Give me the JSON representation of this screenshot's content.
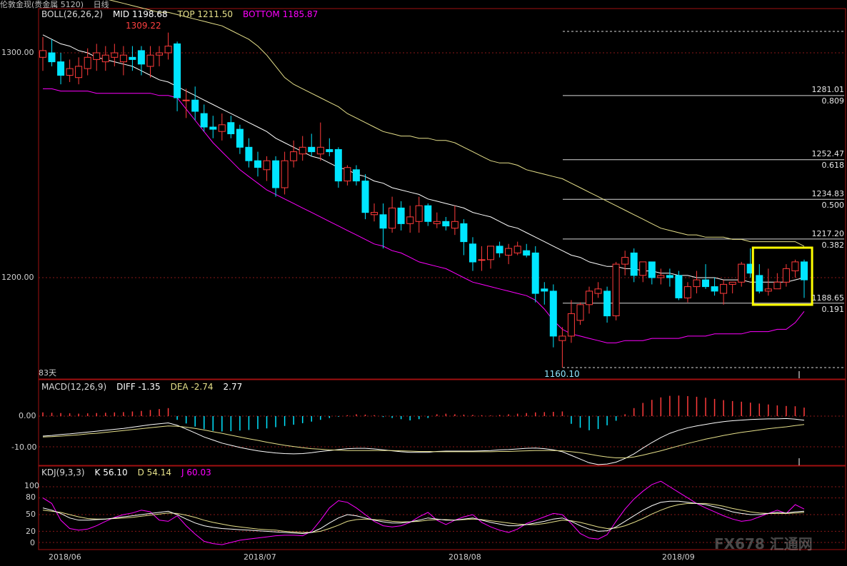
{
  "window": {
    "title": "伦敦金现(贵金属 5120)",
    "period": "日线"
  },
  "panels": {
    "main": {
      "indicator": "BOLL(26,26,2)",
      "mid": "MID 1198.68",
      "top": "TOP 1211.50",
      "bottom": "BOTTOM 1185.87",
      "high_label": "1309.22",
      "low_label": "1160.10",
      "days_label": "83天",
      "y_ticks": [
        "1300.00",
        "1200.00"
      ]
    },
    "macd": {
      "indicator": "MACD(12,26,9)",
      "diff": "DIFF -1.35",
      "dea": "DEA -2.74",
      "macd_val": "2.77",
      "y_ticks": [
        "0.00",
        "-10.00"
      ]
    },
    "kdj": {
      "indicator": "KDJ(9,3,3)",
      "k": "K 56.10",
      "d": "D 54.14",
      "j": "J 60.03",
      "y_ticks": [
        "100",
        "80",
        "50",
        "20",
        "0"
      ]
    }
  },
  "x_labels": [
    "2018/06",
    "2018/07",
    "2018/08",
    "2018/09"
  ],
  "fib_levels": [
    {
      "price": "1281.01",
      "ratio": "0.809"
    },
    {
      "price": "1252.47",
      "ratio": "0.618"
    },
    {
      "price": "1234.83",
      "ratio": "0.500"
    },
    {
      "price": "1217.20",
      "ratio": "0.382"
    },
    {
      "price": "1188.65",
      "ratio": "0.191"
    }
  ],
  "watermark": "FX678 汇通网",
  "colors": {
    "up": "#ff3b3b",
    "down": "#00e5ff",
    "mid": "#ffffff",
    "upper_band": "#e6e08a",
    "lower_band": "#ff00ff",
    "k_line": "#ffffff",
    "d_line": "#e6e08a",
    "j_line": "#ff00ff",
    "highlight_box": "#ffff00",
    "frame": "#a01010"
  },
  "chart_data": {
    "type": "candlestick",
    "ylim": [
      1150,
      1320
    ],
    "candles": [
      {
        "o": 1298,
        "h": 1307,
        "l": 1292,
        "c": 1301
      },
      {
        "o": 1300,
        "h": 1306,
        "l": 1294,
        "c": 1296
      },
      {
        "o": 1296,
        "h": 1300,
        "l": 1286,
        "c": 1290
      },
      {
        "o": 1290,
        "h": 1297,
        "l": 1287,
        "c": 1293
      },
      {
        "o": 1289,
        "h": 1298,
        "l": 1286,
        "c": 1294
      },
      {
        "o": 1293,
        "h": 1302,
        "l": 1290,
        "c": 1298
      },
      {
        "o": 1297,
        "h": 1304,
        "l": 1292,
        "c": 1300
      },
      {
        "o": 1296,
        "h": 1303,
        "l": 1292,
        "c": 1299
      },
      {
        "o": 1298,
        "h": 1304,
        "l": 1294,
        "c": 1300
      },
      {
        "o": 1296,
        "h": 1303,
        "l": 1290,
        "c": 1299
      },
      {
        "o": 1298,
        "h": 1303,
        "l": 1292,
        "c": 1297
      },
      {
        "o": 1301,
        "h": 1303,
        "l": 1290,
        "c": 1295
      },
      {
        "o": 1294,
        "h": 1303,
        "l": 1289,
        "c": 1299
      },
      {
        "o": 1299,
        "h": 1303,
        "l": 1294,
        "c": 1300
      },
      {
        "o": 1300,
        "h": 1309,
        "l": 1297,
        "c": 1303
      },
      {
        "o": 1304,
        "h": 1305,
        "l": 1274,
        "c": 1280
      },
      {
        "o": 1279,
        "h": 1284,
        "l": 1271,
        "c": 1279
      },
      {
        "o": 1279,
        "h": 1285,
        "l": 1270,
        "c": 1274
      },
      {
        "o": 1273,
        "h": 1277,
        "l": 1265,
        "c": 1267
      },
      {
        "o": 1267,
        "h": 1272,
        "l": 1262,
        "c": 1266
      },
      {
        "o": 1265,
        "h": 1273,
        "l": 1261,
        "c": 1268
      },
      {
        "o": 1269,
        "h": 1272,
        "l": 1262,
        "c": 1264
      },
      {
        "o": 1266,
        "h": 1268,
        "l": 1255,
        "c": 1258
      },
      {
        "o": 1258,
        "h": 1262,
        "l": 1249,
        "c": 1252
      },
      {
        "o": 1252,
        "h": 1256,
        "l": 1245,
        "c": 1249
      },
      {
        "o": 1248,
        "h": 1254,
        "l": 1243,
        "c": 1252
      },
      {
        "o": 1252,
        "h": 1254,
        "l": 1236,
        "c": 1240
      },
      {
        "o": 1240,
        "h": 1256,
        "l": 1237,
        "c": 1252
      },
      {
        "o": 1252,
        "h": 1261,
        "l": 1249,
        "c": 1256
      },
      {
        "o": 1255,
        "h": 1263,
        "l": 1252,
        "c": 1258
      },
      {
        "o": 1258,
        "h": 1264,
        "l": 1254,
        "c": 1256
      },
      {
        "o": 1255,
        "h": 1269,
        "l": 1252,
        "c": 1258
      },
      {
        "o": 1257,
        "h": 1262,
        "l": 1254,
        "c": 1256
      },
      {
        "o": 1257,
        "h": 1258,
        "l": 1240,
        "c": 1243
      },
      {
        "o": 1243,
        "h": 1250,
        "l": 1241,
        "c": 1249
      },
      {
        "o": 1248,
        "h": 1250,
        "l": 1241,
        "c": 1243
      },
      {
        "o": 1243,
        "h": 1246,
        "l": 1226,
        "c": 1229
      },
      {
        "o": 1228,
        "h": 1233,
        "l": 1225,
        "c": 1229
      },
      {
        "o": 1228,
        "h": 1233,
        "l": 1213,
        "c": 1222
      },
      {
        "o": 1222,
        "h": 1236,
        "l": 1220,
        "c": 1231
      },
      {
        "o": 1231,
        "h": 1234,
        "l": 1221,
        "c": 1224
      },
      {
        "o": 1224,
        "h": 1232,
        "l": 1220,
        "c": 1227
      },
      {
        "o": 1225,
        "h": 1236,
        "l": 1220,
        "c": 1232
      },
      {
        "o": 1232,
        "h": 1233,
        "l": 1223,
        "c": 1225
      },
      {
        "o": 1224,
        "h": 1229,
        "l": 1222,
        "c": 1225
      },
      {
        "o": 1225,
        "h": 1227,
        "l": 1221,
        "c": 1223
      },
      {
        "o": 1222,
        "h": 1232,
        "l": 1219,
        "c": 1225
      },
      {
        "o": 1224,
        "h": 1226,
        "l": 1210,
        "c": 1216
      },
      {
        "o": 1215,
        "h": 1218,
        "l": 1203,
        "c": 1207
      },
      {
        "o": 1208,
        "h": 1214,
        "l": 1203,
        "c": 1208
      },
      {
        "o": 1208,
        "h": 1214,
        "l": 1204,
        "c": 1214
      },
      {
        "o": 1214,
        "h": 1216,
        "l": 1209,
        "c": 1211
      },
      {
        "o": 1210,
        "h": 1215,
        "l": 1206,
        "c": 1213
      },
      {
        "o": 1211,
        "h": 1216,
        "l": 1210,
        "c": 1214
      },
      {
        "o": 1212,
        "h": 1215,
        "l": 1209,
        "c": 1210
      },
      {
        "o": 1211,
        "h": 1214,
        "l": 1189,
        "c": 1193
      },
      {
        "o": 1195,
        "h": 1198,
        "l": 1188,
        "c": 1194
      },
      {
        "o": 1194,
        "h": 1197,
        "l": 1169,
        "c": 1174
      },
      {
        "o": 1172,
        "h": 1178,
        "l": 1160,
        "c": 1174
      },
      {
        "o": 1174,
        "h": 1190,
        "l": 1171,
        "c": 1184
      },
      {
        "o": 1181,
        "h": 1189,
        "l": 1179,
        "c": 1188
      },
      {
        "o": 1188,
        "h": 1196,
        "l": 1184,
        "c": 1194
      },
      {
        "o": 1193,
        "h": 1198,
        "l": 1191,
        "c": 1195
      },
      {
        "o": 1194,
        "h": 1196,
        "l": 1180,
        "c": 1183
      },
      {
        "o": 1183,
        "h": 1207,
        "l": 1181,
        "c": 1206
      },
      {
        "o": 1206,
        "h": 1212,
        "l": 1201,
        "c": 1209
      },
      {
        "o": 1211,
        "h": 1213,
        "l": 1198,
        "c": 1201
      },
      {
        "o": 1201,
        "h": 1206,
        "l": 1198,
        "c": 1207
      },
      {
        "o": 1207,
        "h": 1207,
        "l": 1197,
        "c": 1200
      },
      {
        "o": 1200,
        "h": 1204,
        "l": 1197,
        "c": 1201
      },
      {
        "o": 1201,
        "h": 1204,
        "l": 1196,
        "c": 1200
      },
      {
        "o": 1201,
        "h": 1203,
        "l": 1190,
        "c": 1191
      },
      {
        "o": 1191,
        "h": 1198,
        "l": 1189,
        "c": 1196
      },
      {
        "o": 1196,
        "h": 1203,
        "l": 1193,
        "c": 1199
      },
      {
        "o": 1199,
        "h": 1206,
        "l": 1195,
        "c": 1196
      },
      {
        "o": 1196,
        "h": 1200,
        "l": 1192,
        "c": 1194
      },
      {
        "o": 1193,
        "h": 1199,
        "l": 1188,
        "c": 1197
      },
      {
        "o": 1197,
        "h": 1198,
        "l": 1193,
        "c": 1198
      },
      {
        "o": 1198,
        "h": 1207,
        "l": 1196,
        "c": 1206
      },
      {
        "o": 1206,
        "h": 1213,
        "l": 1200,
        "c": 1202
      },
      {
        "o": 1201,
        "h": 1206,
        "l": 1193,
        "c": 1194
      },
      {
        "o": 1194,
        "h": 1204,
        "l": 1192,
        "c": 1195
      },
      {
        "o": 1195,
        "h": 1202,
        "l": 1196,
        "c": 1198
      },
      {
        "o": 1198,
        "h": 1206,
        "l": 1196,
        "c": 1204
      },
      {
        "o": 1203,
        "h": 1208,
        "l": 1200,
        "c": 1207
      },
      {
        "o": 1207,
        "h": 1208,
        "l": 1191,
        "c": 1199
      }
    ],
    "mid": [
      1308,
      1306,
      1304,
      1303,
      1301,
      1300,
      1298,
      1297,
      1296,
      1295,
      1294,
      1292,
      1290,
      1288,
      1287,
      1285,
      1283,
      1281,
      1279,
      1277,
      1275,
      1273,
      1271,
      1269,
      1267,
      1265,
      1262,
      1260,
      1258,
      1256,
      1254,
      1253,
      1251,
      1249,
      1248,
      1246,
      1245,
      1243,
      1242,
      1240,
      1239,
      1238,
      1237,
      1235,
      1234,
      1233,
      1232,
      1231,
      1229,
      1228,
      1227,
      1225,
      1223,
      1222,
      1220,
      1218,
      1216,
      1214,
      1212,
      1210,
      1209,
      1207,
      1206,
      1205,
      1205,
      1204,
      1204,
      1203,
      1203,
      1202,
      1202,
      1201,
      1201,
      1200,
      1200,
      1200,
      1199,
      1199,
      1199,
      1198,
      1198,
      1198,
      1198,
      1198,
      1199,
      1200
    ],
    "upper": [
      1333,
      1331,
      1330,
      1328,
      1327,
      1326,
      1325,
      1324,
      1323,
      1322,
      1321,
      1320,
      1319,
      1318,
      1318,
      1317,
      1316,
      1315,
      1314,
      1313,
      1312,
      1310,
      1308,
      1306,
      1303,
      1299,
      1294,
      1289,
      1286,
      1284,
      1282,
      1280,
      1278,
      1276,
      1273,
      1271,
      1269,
      1267,
      1265,
      1264,
      1263,
      1263,
      1262,
      1262,
      1261,
      1261,
      1260,
      1258,
      1256,
      1254,
      1252,
      1251,
      1251,
      1250,
      1248,
      1247,
      1246,
      1245,
      1244,
      1242,
      1240,
      1238,
      1236,
      1234,
      1232,
      1230,
      1228,
      1226,
      1224,
      1222,
      1221,
      1220,
      1219,
      1219,
      1218,
      1218,
      1218,
      1217,
      1217,
      1216,
      1216,
      1216,
      1216,
      1216,
      1216,
      1214
    ],
    "lower": [
      1284,
      1284,
      1283,
      1283,
      1283,
      1283,
      1282,
      1282,
      1282,
      1282,
      1282,
      1282,
      1282,
      1281,
      1281,
      1280,
      1275,
      1270,
      1265,
      1260,
      1256,
      1252,
      1248,
      1245,
      1242,
      1239,
      1237,
      1235,
      1233,
      1231,
      1229,
      1227,
      1225,
      1223,
      1221,
      1219,
      1217,
      1215,
      1214,
      1212,
      1211,
      1209,
      1207,
      1206,
      1205,
      1204,
      1202,
      1200,
      1198,
      1197,
      1196,
      1195,
      1194,
      1193,
      1192,
      1190,
      1186,
      1181,
      1177,
      1175,
      1174,
      1173,
      1172,
      1171,
      1171,
      1172,
      1172,
      1172,
      1173,
      1173,
      1173,
      1173,
      1174,
      1174,
      1174,
      1175,
      1175,
      1175,
      1175,
      1176,
      1176,
      1176,
      1177,
      1177,
      1180,
      1185
    ],
    "macd_hist": [
      1.2,
      1.1,
      1.0,
      0.9,
      0.8,
      0.9,
      1.0,
      1.1,
      1.2,
      1.3,
      1.5,
      1.7,
      2.0,
      2.3,
      2.6,
      -1.2,
      -2.4,
      -3.4,
      -4.2,
      -4.8,
      -5.0,
      -4.9,
      -4.7,
      -4.5,
      -4.2,
      -4.0,
      -3.6,
      -3.2,
      -2.8,
      -2.3,
      -1.8,
      -1.2,
      -0.6,
      -0.2,
      0.3,
      0.6,
      0.5,
      0.3,
      -0.3,
      -0.6,
      -1.0,
      -1.4,
      -1.0,
      -0.6,
      0.6,
      0.8,
      0.6,
      0.5,
      0.4,
      0.3,
      0.2,
      0.4,
      0.6,
      0.8,
      1.0,
      1.2,
      1.3,
      1.4,
      1.5,
      -2.5,
      -3.8,
      -4.6,
      -4.2,
      -3.0,
      -1.5,
      0.6,
      2.6,
      4.3,
      5.3,
      6.1,
      6.6,
      6.7,
      6.5,
      6.3,
      6.0,
      5.6,
      5.2,
      4.9,
      4.7,
      4.4,
      4.1,
      3.8,
      3.5,
      3.3,
      3.2,
      2.77
    ],
    "macd_diff": [
      -6.5,
      -6.3,
      -6.0,
      -5.8,
      -5.5,
      -5.2,
      -4.9,
      -4.6,
      -4.3,
      -4.0,
      -3.6,
      -3.2,
      -2.8,
      -2.5,
      -2.2,
      -3.0,
      -4.2,
      -5.5,
      -6.8,
      -7.8,
      -8.8,
      -9.5,
      -10.2,
      -10.8,
      -11.3,
      -11.7,
      -12.0,
      -12.2,
      -12.3,
      -12.2,
      -11.9,
      -11.5,
      -11.2,
      -10.9,
      -10.6,
      -10.5,
      -10.5,
      -10.7,
      -11.0,
      -11.3,
      -11.6,
      -11.8,
      -11.8,
      -11.8,
      -11.5,
      -11.4,
      -11.4,
      -11.4,
      -11.4,
      -11.3,
      -11.2,
      -11.0,
      -10.9,
      -10.7,
      -10.5,
      -10.4,
      -10.6,
      -11.0,
      -11.6,
      -12.8,
      -14.0,
      -15.2,
      -15.8,
      -15.6,
      -15.0,
      -13.8,
      -12.3,
      -10.4,
      -8.6,
      -7.0,
      -5.6,
      -4.6,
      -3.8,
      -3.2,
      -2.7,
      -2.2,
      -1.8,
      -1.5,
      -1.3,
      -1.1,
      -1.0,
      -0.9,
      -0.9,
      -0.8,
      -1.0,
      -1.35
    ],
    "macd_dea": [
      -6.8,
      -6.7,
      -6.5,
      -6.3,
      -6.1,
      -5.8,
      -5.6,
      -5.3,
      -5.0,
      -4.7,
      -4.4,
      -4.1,
      -3.8,
      -3.5,
      -3.2,
      -3.3,
      -3.6,
      -4.0,
      -4.5,
      -5.1,
      -5.6,
      -6.2,
      -6.8,
      -7.4,
      -7.9,
      -8.5,
      -9.0,
      -9.5,
      -9.9,
      -10.3,
      -10.6,
      -10.8,
      -11.0,
      -11.1,
      -11.2,
      -11.2,
      -11.2,
      -11.2,
      -11.2,
      -11.2,
      -11.3,
      -11.4,
      -11.5,
      -11.5,
      -11.6,
      -11.6,
      -11.6,
      -11.6,
      -11.6,
      -11.6,
      -11.6,
      -11.5,
      -11.5,
      -11.4,
      -11.3,
      -11.2,
      -11.2,
      -11.2,
      -11.3,
      -11.6,
      -11.9,
      -12.4,
      -12.9,
      -13.3,
      -13.6,
      -13.6,
      -13.3,
      -12.7,
      -12.0,
      -11.3,
      -10.5,
      -9.7,
      -8.9,
      -8.2,
      -7.5,
      -6.9,
      -6.3,
      -5.8,
      -5.3,
      -4.9,
      -4.5,
      -4.1,
      -3.8,
      -3.5,
      -3.1,
      -2.74
    ],
    "kdj_k": [
      62,
      58,
      52,
      44,
      40,
      40,
      41,
      42,
      44,
      46,
      48,
      50,
      52,
      54,
      56,
      50,
      42,
      35,
      30,
      27,
      25,
      24,
      23,
      22,
      21,
      20,
      19,
      18,
      17,
      16,
      18,
      25,
      35,
      44,
      50,
      48,
      44,
      40,
      37,
      35,
      35,
      37,
      40,
      44,
      42,
      40,
      40,
      42,
      44,
      40,
      36,
      33,
      30,
      30,
      32,
      35,
      38,
      42,
      44,
      38,
      30,
      24,
      20,
      21,
      28,
      38,
      48,
      58,
      66,
      72,
      74,
      74,
      72,
      70,
      68,
      64,
      60,
      55,
      52,
      50,
      50,
      52,
      54,
      53,
      55,
      56
    ],
    "kdj_d": [
      58,
      56,
      54,
      50,
      46,
      43,
      42,
      42,
      43,
      44,
      45,
      47,
      49,
      51,
      53,
      52,
      49,
      45,
      40,
      36,
      33,
      30,
      28,
      26,
      24,
      23,
      22,
      20,
      19,
      18,
      18,
      20,
      25,
      31,
      38,
      41,
      42,
      41,
      40,
      38,
      37,
      37,
      38,
      40,
      41,
      41,
      40,
      41,
      42,
      41,
      39,
      37,
      35,
      33,
      32,
      32,
      34,
      37,
      40,
      39,
      36,
      32,
      28,
      25,
      26,
      30,
      36,
      43,
      51,
      58,
      64,
      68,
      70,
      70,
      70,
      68,
      65,
      61,
      58,
      55,
      53,
      52,
      52,
      52,
      53,
      54
    ],
    "kdj_j": [
      80,
      70,
      40,
      25,
      22,
      24,
      30,
      38,
      45,
      50,
      53,
      58,
      55,
      40,
      38,
      48,
      30,
      15,
      2,
      -2,
      -4,
      0,
      4,
      6,
      8,
      10,
      12,
      13,
      13,
      12,
      20,
      40,
      62,
      75,
      72,
      62,
      50,
      38,
      30,
      28,
      30,
      36,
      46,
      54,
      40,
      32,
      40,
      46,
      50,
      36,
      28,
      22,
      18,
      24,
      34,
      40,
      46,
      52,
      50,
      34,
      16,
      8,
      6,
      14,
      38,
      60,
      78,
      92,
      104,
      110,
      100,
      90,
      80,
      70,
      62,
      55,
      48,
      42,
      38,
      40,
      46,
      52,
      58,
      52,
      68,
      60
    ]
  }
}
